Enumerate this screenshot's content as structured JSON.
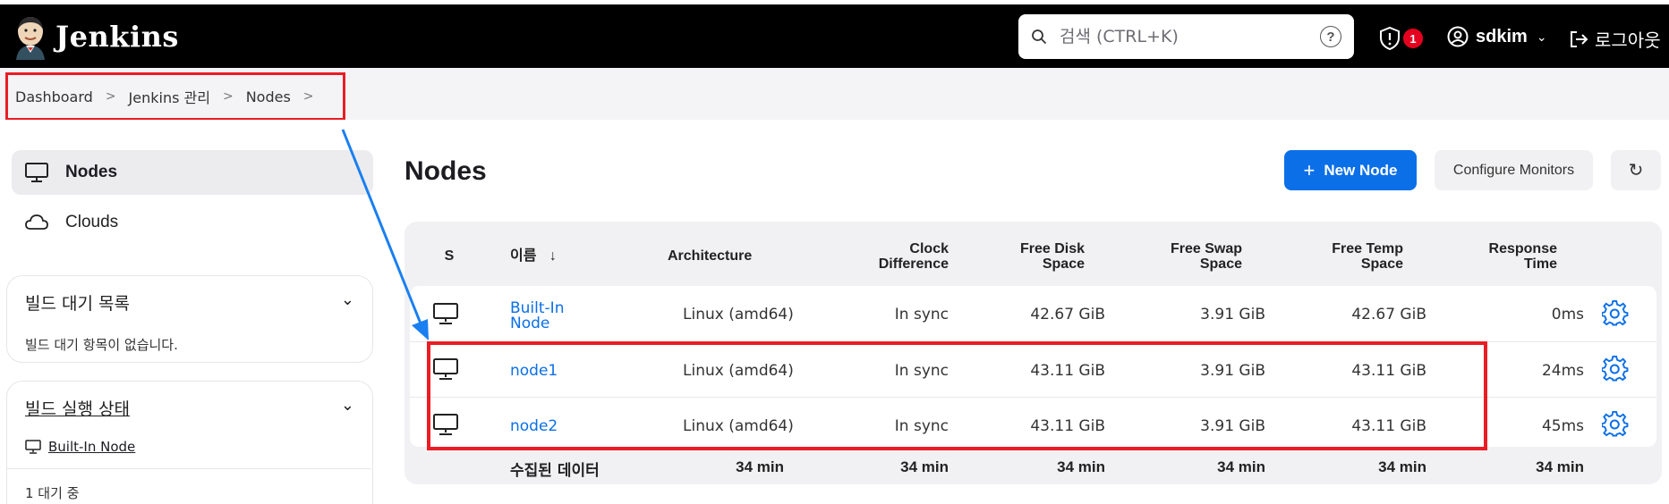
{
  "header": {
    "app_name": "Jenkins",
    "search_placeholder": "검색 (CTRL+K)",
    "help": "?",
    "security_count": "1",
    "username": "sdkim",
    "logout": "로그아웃"
  },
  "breadcrumb": [
    "Dashboard",
    "Jenkins 관리",
    "Nodes"
  ],
  "sidebar": {
    "items": [
      {
        "label": "Nodes",
        "icon": "computer-icon",
        "active": true
      },
      {
        "label": "Clouds",
        "icon": "cloud-icon",
        "active": false
      }
    ],
    "build_queue": {
      "title": "빌드 대기 목록",
      "empty_text": "빌드 대기 항목이 없습니다."
    },
    "executor_status": {
      "title": "빌드 실행 상태",
      "node_link": "Built-In Node",
      "status": "1 대기 중"
    }
  },
  "main": {
    "title": "Nodes",
    "new_node_label": "New Node",
    "configure_monitors_label": "Configure Monitors"
  },
  "table": {
    "headers": {
      "s": "S",
      "name": "이름",
      "sort": "↓",
      "architecture": "Architecture",
      "clock": [
        "Clock",
        "Difference"
      ],
      "disk": [
        "Free Disk",
        "Space"
      ],
      "swap": [
        "Free Swap",
        "Space"
      ],
      "temp": [
        "Free Temp",
        "Space"
      ],
      "response": [
        "Response",
        "Time"
      ]
    },
    "rows": [
      {
        "name": [
          "Built-In",
          "Node"
        ],
        "architecture": "Linux (amd64)",
        "clock": "In sync",
        "disk": "42.67 GiB",
        "swap": "3.91 GiB",
        "temp": "42.67 GiB",
        "response": "0ms"
      },
      {
        "name": [
          "node1"
        ],
        "architecture": "Linux (amd64)",
        "clock": "In sync",
        "disk": "43.11 GiB",
        "swap": "3.91 GiB",
        "temp": "43.11 GiB",
        "response": "24ms"
      },
      {
        "name": [
          "node2"
        ],
        "architecture": "Linux (amd64)",
        "clock": "In sync",
        "disk": "43.11 GiB",
        "swap": "3.91 GiB",
        "temp": "43.11 GiB",
        "response": "45ms"
      }
    ],
    "footer": {
      "label": "수집된 데이터",
      "ages": [
        "34 min",
        "34 min",
        "34 min",
        "34 min",
        "34 min",
        "34 min"
      ]
    }
  },
  "colors": {
    "accent": "#0b6fe8",
    "annotation": "#ea1c24",
    "arrow": "#1a7ff0",
    "badge": "#e6001f"
  }
}
